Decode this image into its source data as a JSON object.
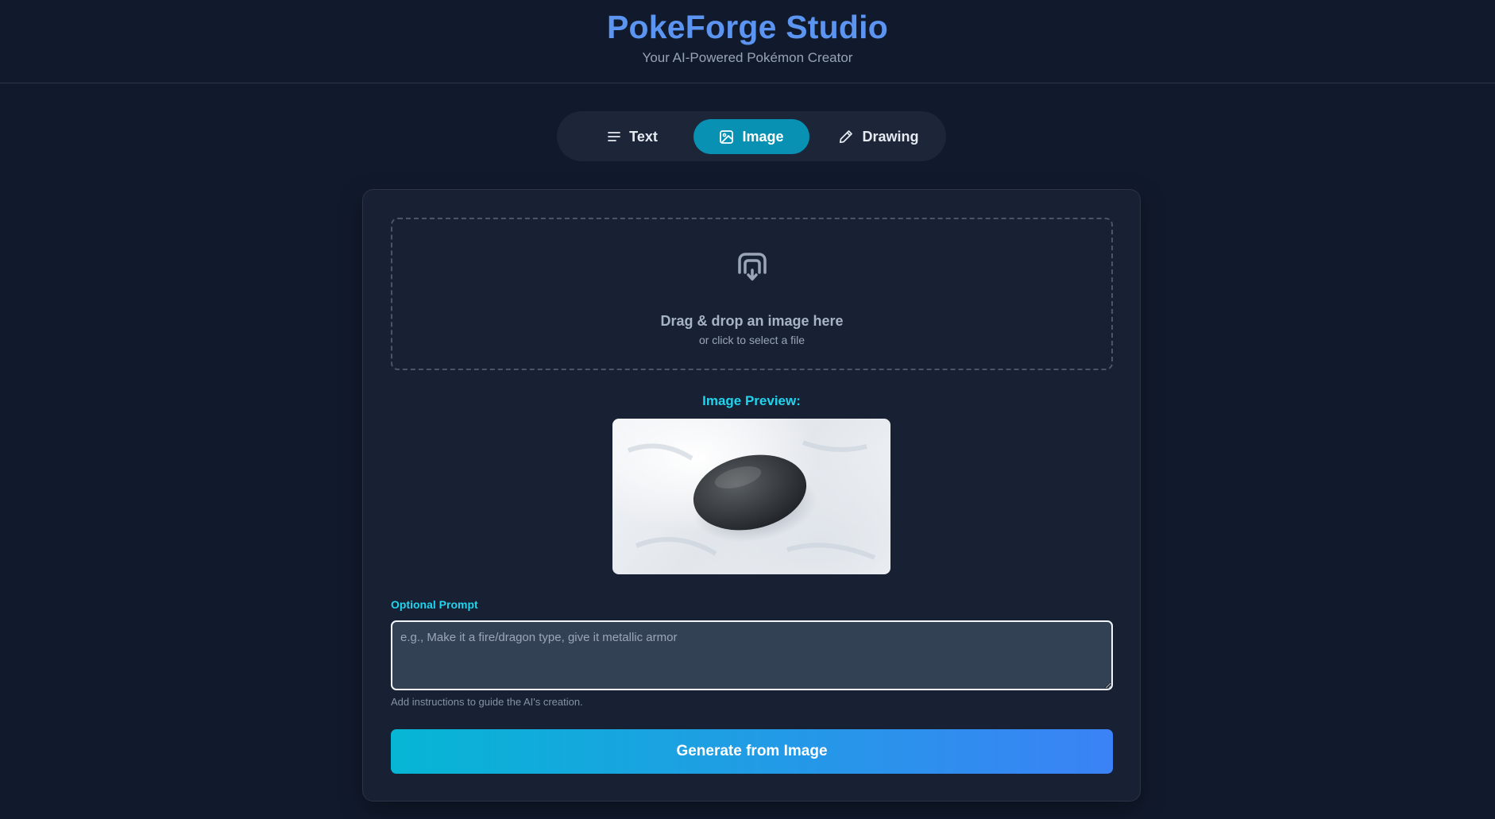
{
  "header": {
    "title": "PokeForge Studio",
    "subtitle": "Your AI-Powered Pokémon Creator"
  },
  "tabs": [
    {
      "label": "Text",
      "icon": "lines-icon",
      "active": false
    },
    {
      "label": "Image",
      "icon": "image-icon",
      "active": true
    },
    {
      "label": "Drawing",
      "icon": "pencil-icon",
      "active": false
    }
  ],
  "dropzone": {
    "icon": "upload-icon",
    "main_text": "Drag & drop an image here",
    "sub_text": "or click to select a file"
  },
  "preview": {
    "label": "Image Preview:",
    "image_subject": "dark smooth stone on snow"
  },
  "prompt": {
    "label": "Optional Prompt",
    "value": "",
    "placeholder": "e.g., Make it a fire/dragon type, give it metallic armor",
    "help": "Add instructions to guide the AI's creation."
  },
  "generate": {
    "label": "Generate from Image"
  },
  "colors": {
    "background": "#111a2c",
    "card": "#172133",
    "title": "#5b95f1",
    "accent_cyan": "#22d3ee",
    "active_tab": "#0891b2",
    "gradient_start": "#06b6d4",
    "gradient_end": "#3b82f6"
  }
}
